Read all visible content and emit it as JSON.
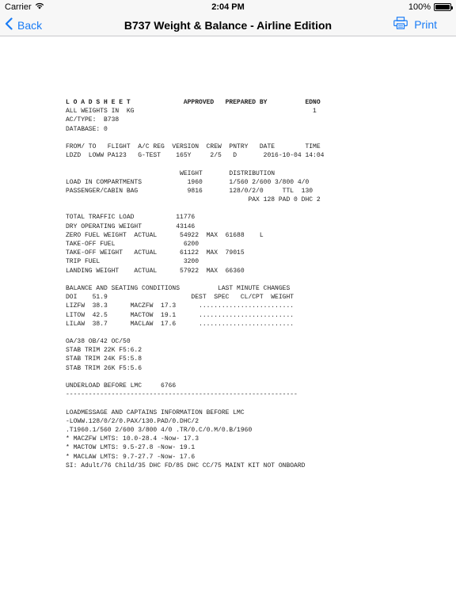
{
  "status_bar": {
    "carrier": "Carrier",
    "time": "2:04 PM",
    "battery": "100%",
    "battery_level": 1.0
  },
  "nav": {
    "back_label": "Back",
    "title": "B737 Weight & Balance - Airline Edition",
    "print_label": "Print",
    "accent_color": "#1a7cf5"
  },
  "icons": {
    "wifi": "wifi-icon",
    "battery": "battery-icon",
    "back": "chevron-left-icon",
    "print": "printer-icon"
  },
  "loadsheet": {
    "lines": [
      "L O A D S H E E T              APPROVED   PREPARED BY          EDNO",
      "ALL WEIGHTS IN  KG                                               1",
      "AC/TYPE:  B738",
      "DATABASE: 0",
      "",
      "FROM/ TO   FLIGHT  A/C REG  VERSION  CREW  PNTRY   DATE        TIME",
      "LDZD  LOWW PA123   G-TEST    165Y     2/5   D       2016-10-04 14:04",
      "",
      "                              WEIGHT       DISTRIBUTION",
      "LOAD IN COMPARTMENTS            1960       1/560 2/600 3/800 4/0",
      "PASSENGER/CABIN BAG             9816       128/0/2/0     TTL  130",
      "                                                PAX 128 PAD 0 DHC 2",
      "",
      "TOTAL TRAFFIC LOAD           11776",
      "DRY OPERATING WEIGHT         43146",
      "ZERO FUEL WEIGHT  ACTUAL      54922  MAX  61688    L",
      "TAKE-OFF FUEL                  6200",
      "TAKE-OFF WEIGHT   ACTUAL      61122  MAX  79015",
      "TRIP FUEL                      3200",
      "LANDING WEIGHT    ACTUAL      57922  MAX  66360",
      "",
      "BALANCE AND SEATING CONDITIONS          LAST MINUTE CHANGES",
      "DOI    51.9                      DEST  SPEC   CL/CPT  WEIGHT",
      "LIZFW  38.3      MACZFW  17.3      .........................",
      "LITOW  42.5      MACTOW  19.1      .........................",
      "LILAW  38.7      MACLAW  17.6      .........................",
      "",
      "OA/38 OB/42 OC/50",
      "STAB TRIM 22K F5:6.2",
      "STAB TRIM 24K F5:5.8",
      "STAB TRIM 26K F5:5.6",
      "",
      "UNDERLOAD BEFORE LMC     6766",
      "-------------------------------------------------------------",
      "",
      "LOADMESSAGE AND CAPTAINS INFORMATION BEFORE LMC",
      "-LOWW.128/0/2/0.PAX/130.PAD/0.DHC/2",
      ".T1960.1/560 2/600 3/800 4/0 .TR/0.C/0.M/0.B/1960",
      "* MACZFW LMTS: 10.0-28.4 -Now- 17.3",
      "* MACTOW LMTS: 9.5-27.8 -Now- 19.1",
      "* MACLAW LMTS: 9.7-27.7 -Now- 17.6",
      "SI: Adult/76 Child/35 DHC FD/85 DHC CC/75 MAINT KIT NOT ONBOARD"
    ]
  }
}
